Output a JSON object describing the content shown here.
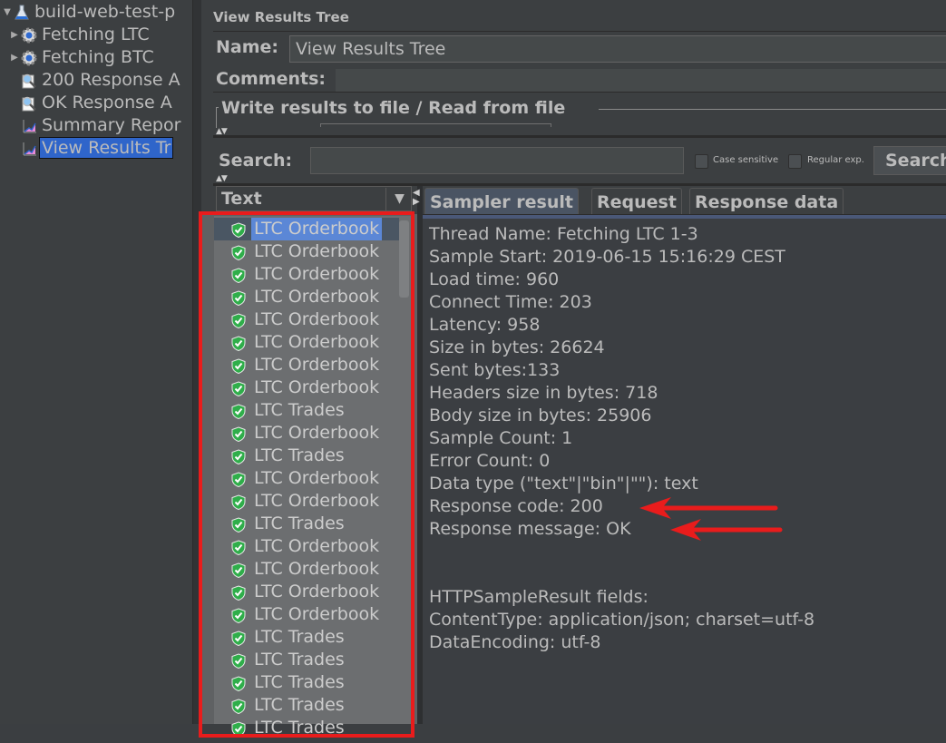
{
  "tree": {
    "root": {
      "label": "build-web-test-p",
      "icon": "flask-icon",
      "expanded": true
    },
    "items": [
      {
        "label": "Fetching LTC",
        "icon": "gear-icon",
        "collapsed": true
      },
      {
        "label": "Fetching BTC",
        "icon": "gear-icon",
        "collapsed": true
      },
      {
        "label": "200 Response A",
        "icon": "magnifier-icon"
      },
      {
        "label": "OK  Response A",
        "icon": "magnifier-icon"
      },
      {
        "label": "Summary Repor",
        "icon": "graph-icon"
      },
      {
        "label": "View Results Tr",
        "icon": "graph-icon",
        "selected": true
      }
    ]
  },
  "panel": {
    "title": "View Results Tree",
    "name_label": "Name:",
    "name_value": "View Results Tree",
    "comments_label": "Comments:",
    "comments_value": "",
    "file_section_label": "Write results to file / Read from file"
  },
  "search": {
    "label": "Search:",
    "value": "",
    "case_sensitive_label": "Case sensitive",
    "case_sensitive_checked": false,
    "regex_label": "Regular exp.",
    "regex_checked": false,
    "button_label": "Search"
  },
  "results": {
    "column_header": "Text",
    "dropdown_glyph": "▼",
    "status_icon": "success-shield-icon",
    "items": [
      {
        "label": "LTC Orderbook",
        "selected": true
      },
      {
        "label": "LTC Orderbook"
      },
      {
        "label": "LTC Orderbook"
      },
      {
        "label": "LTC Orderbook"
      },
      {
        "label": "LTC Orderbook"
      },
      {
        "label": "LTC Orderbook"
      },
      {
        "label": "LTC Orderbook"
      },
      {
        "label": "LTC Orderbook"
      },
      {
        "label": "LTC Trades"
      },
      {
        "label": "LTC Orderbook"
      },
      {
        "label": "LTC Trades"
      },
      {
        "label": "LTC Orderbook"
      },
      {
        "label": "LTC Orderbook"
      },
      {
        "label": "LTC Trades"
      },
      {
        "label": "LTC Orderbook"
      },
      {
        "label": "LTC Orderbook"
      },
      {
        "label": "LTC Orderbook"
      },
      {
        "label": "LTC Orderbook"
      },
      {
        "label": "LTC Trades"
      },
      {
        "label": "LTC Trades"
      },
      {
        "label": "LTC Trades"
      },
      {
        "label": "LTC Trades"
      },
      {
        "label": "LTC Trades"
      }
    ]
  },
  "tabs": [
    {
      "label": "Sampler result",
      "active": true
    },
    {
      "label": "Request"
    },
    {
      "label": "Response data"
    }
  ],
  "sampler_result": {
    "lines": [
      "Thread Name: Fetching LTC 1-3",
      "Sample Start: 2019-06-15 15:16:29 CEST",
      "Load time: 960",
      "Connect Time: 203",
      "Latency: 958",
      "Size in bytes: 26624",
      "Sent bytes:133",
      "Headers size in bytes: 718",
      "Body size in bytes: 25906",
      "Sample Count: 1",
      "Error Count: 0",
      "Data type (\"text\"|\"bin\"|\"\"): text",
      "Response code: 200",
      "Response message: OK",
      "",
      "",
      "HTTPSampleResult fields:",
      "ContentType: application/json; charset=utf-8",
      "DataEncoding: utf-8"
    ]
  },
  "annotations": {
    "highlight_color": "#e91c1c",
    "arrows_point_to": [
      "Response code: 200",
      "Response message: OK"
    ]
  }
}
